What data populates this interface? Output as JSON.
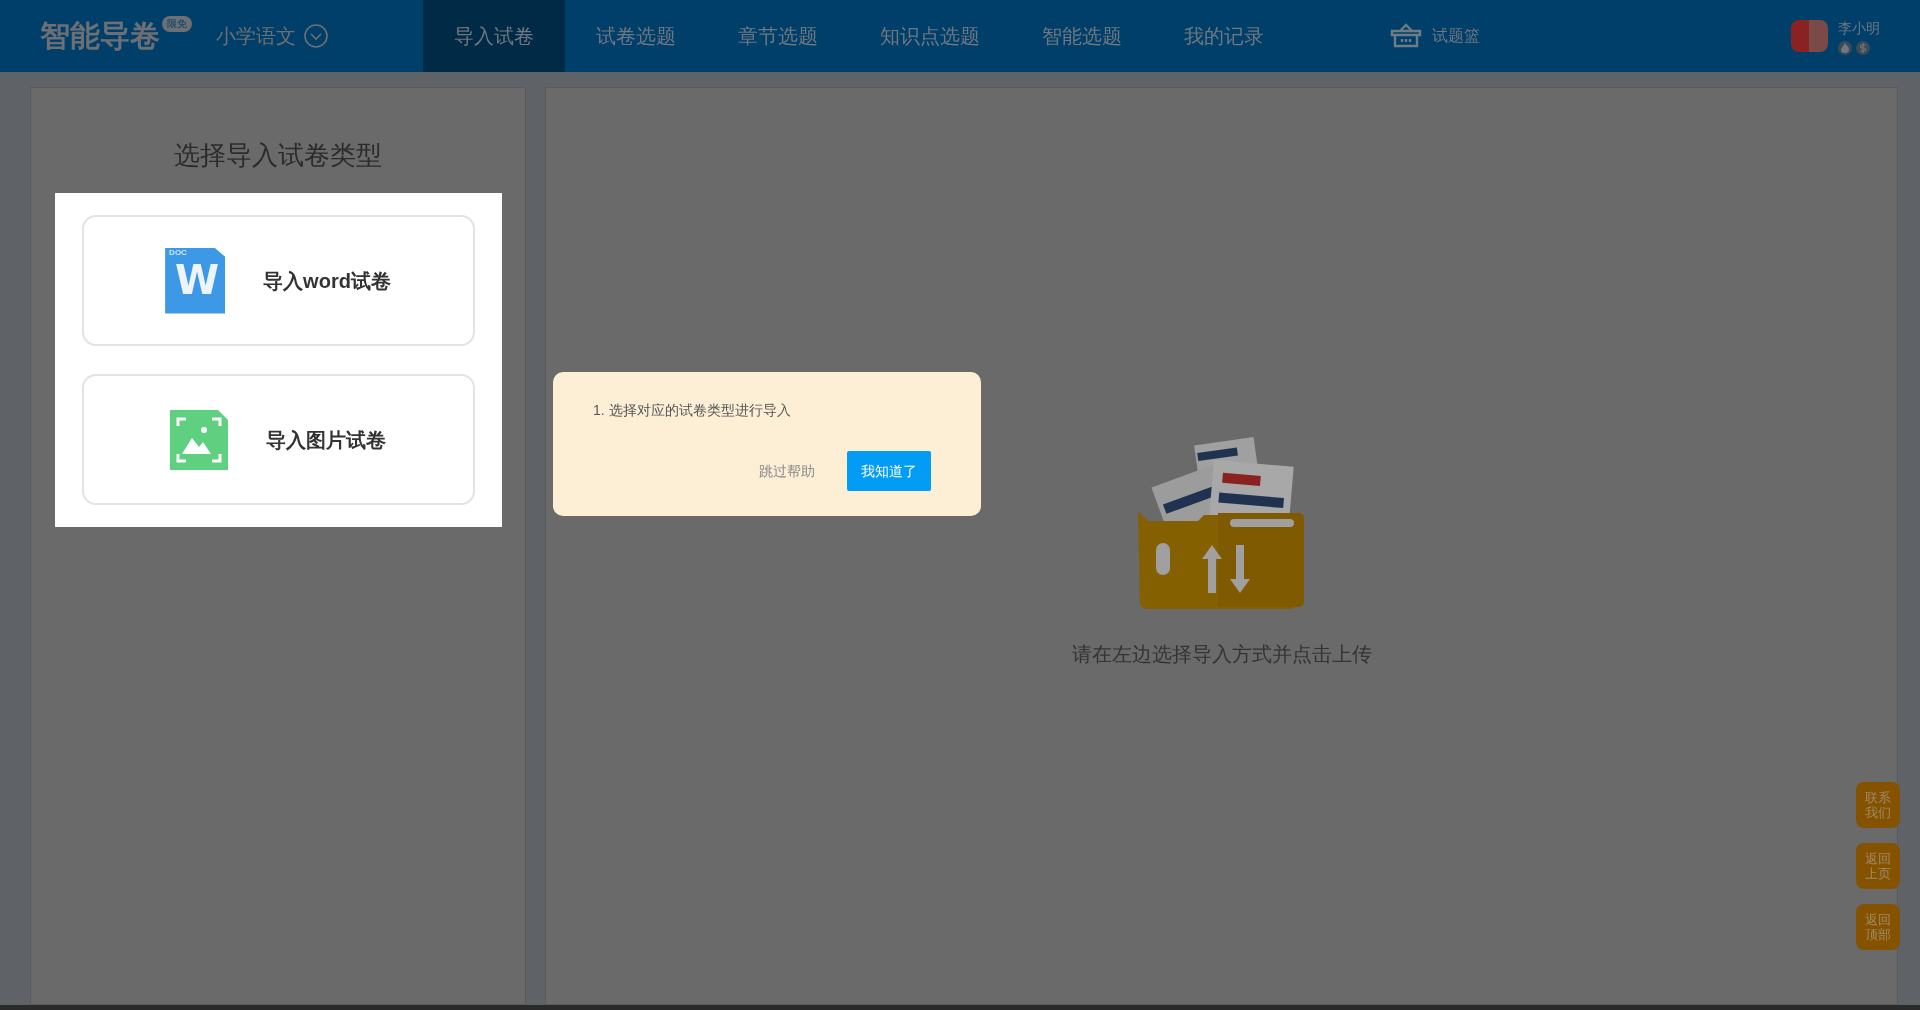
{
  "header": {
    "logo": "智能导卷",
    "logo_badge": "限免",
    "subject": "小学语文",
    "tabs": [
      {
        "label": "导入试卷",
        "selected": true
      },
      {
        "label": "试卷选题",
        "selected": false
      },
      {
        "label": "章节选题",
        "selected": false
      },
      {
        "label": "知识点选题",
        "selected": false
      },
      {
        "label": "智能选题",
        "selected": false
      },
      {
        "label": "我的记录",
        "selected": false
      }
    ],
    "basket": "试题篮",
    "user": {
      "name": "李小明"
    }
  },
  "left_panel": {
    "title": "选择导入试卷类型",
    "highlighted": true,
    "options": [
      {
        "kind": "word",
        "label": "导入word试卷",
        "icon_label": "DOC",
        "icon_letter": "W"
      },
      {
        "kind": "image",
        "label": "导入图片试卷"
      }
    ]
  },
  "main": {
    "empty_text": "请在左边选择导入方式并点击上传"
  },
  "guide": {
    "step": "1. 选择对应的试卷类型进行导入",
    "skip": "跳过帮助",
    "confirm": "我知道了"
  },
  "float_buttons": [
    {
      "line1": "联系",
      "line2": "我们"
    },
    {
      "line1": "返回",
      "line2": "上页"
    },
    {
      "line1": "返回",
      "line2": "顶部"
    }
  ]
}
